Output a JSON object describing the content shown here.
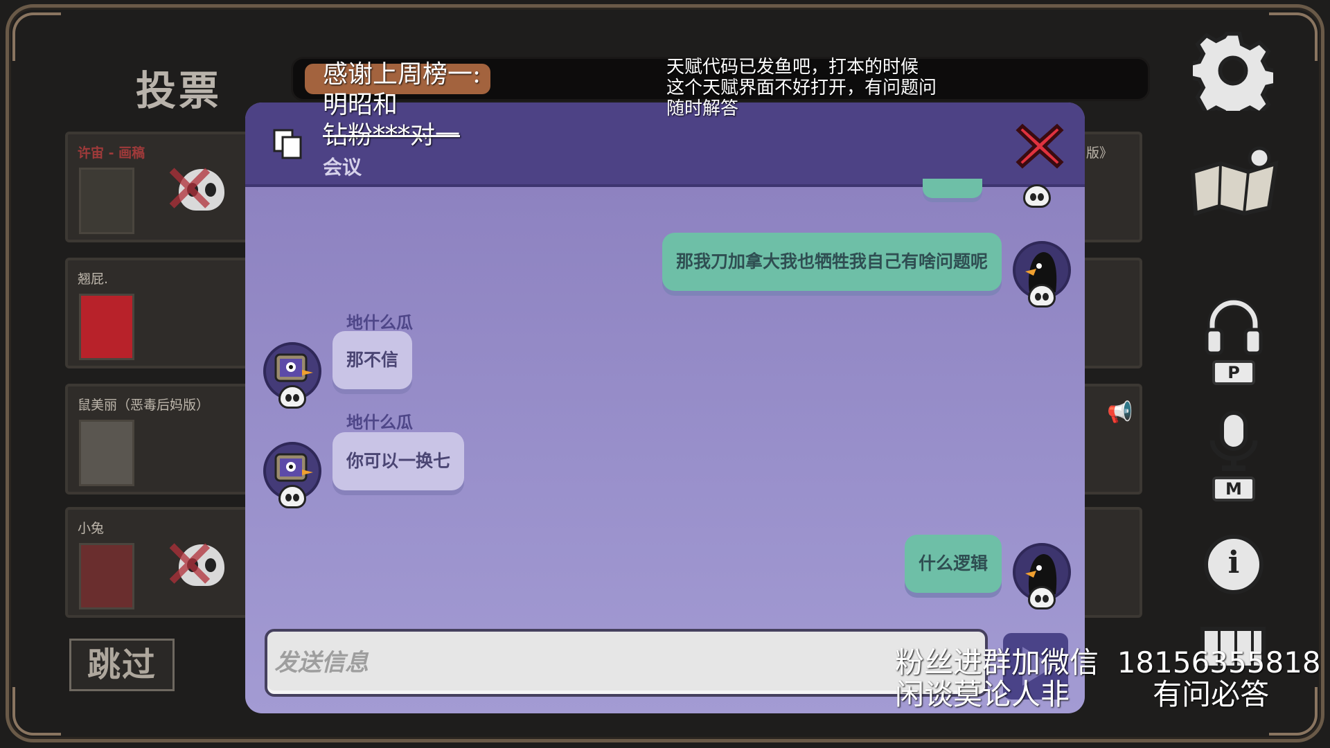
{
  "header": {
    "vote_title": "投票"
  },
  "players": [
    {
      "name": "许宙 - 画稿",
      "dead": true
    },
    {
      "name": "翘屁.",
      "dead": false
    },
    {
      "name": "鼠美丽（恶毒后妈版）",
      "dead": false
    },
    {
      "name": "小兔",
      "dead": true
    }
  ],
  "right_card_fragment": "版》",
  "skip_label": "跳过",
  "side_controls": {
    "voice_key": "P",
    "mic_key": "M"
  },
  "chat": {
    "title": "会议",
    "messages": [
      {
        "sender": "",
        "text": "那我刀加拿大我也牺牲我自己有啥问题呢",
        "mine": true
      },
      {
        "sender": "地什么瓜",
        "text": "那不信",
        "mine": false
      },
      {
        "sender": "地什么瓜",
        "text": "你可以一换七",
        "mine": false
      },
      {
        "sender": "",
        "text": "什么逻辑",
        "mine": true
      }
    ],
    "input_placeholder": "发送信息"
  },
  "overlay": {
    "thanks_line1": "感谢上周榜一:",
    "thanks_line2": "明昭和",
    "thanks_line3": "钻粉***对一",
    "talent_line1": "天赋代码已发鱼吧，打本的时候",
    "talent_line2": "这个天赋界面不好打开，有问题问",
    "talent_line3": "随时解答",
    "fans_line1": "粉丝进群加微信  18156355818",
    "fans_line2": "闲谈莫论人非         有问必答"
  },
  "colors": {
    "panel": "#9990cb",
    "header": "#4d4285",
    "mine_bubble": "#6ebfa7",
    "other_bubble": "#c9c4e6",
    "close_red": "#e0323f"
  }
}
